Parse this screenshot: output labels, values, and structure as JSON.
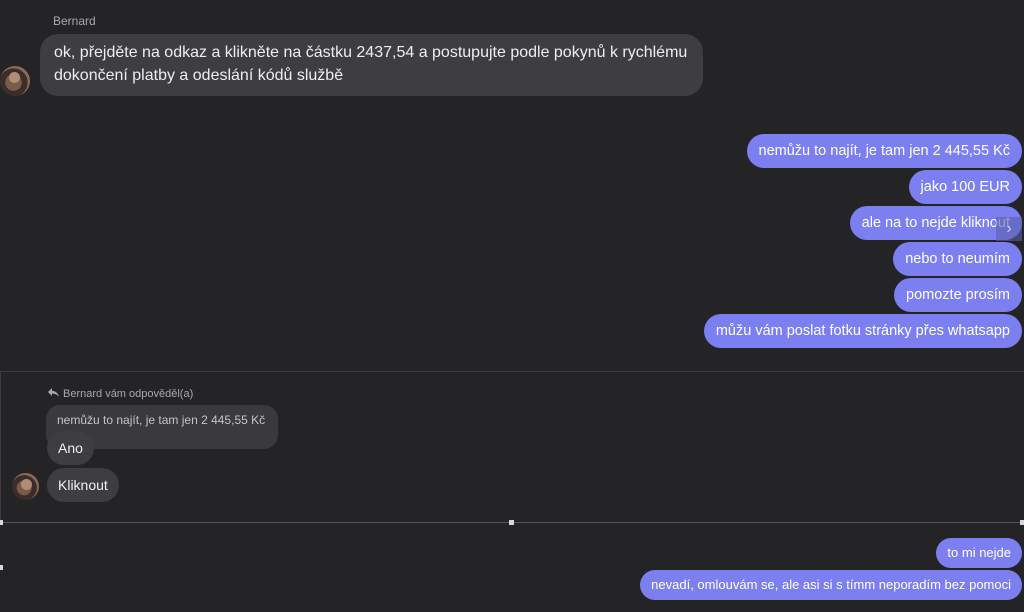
{
  "top_thread": {
    "sender": "Bernard",
    "incoming_message": "ok, přejděte na odkaz a klikněte na částku 2437,54 a postupujte podle pokynů k rychlému dokončení platby a odeslání kódů službě",
    "outgoing": [
      "nemůžu to najít, je tam jen 2 445,55 Kč",
      "jako 100 EUR",
      "ale na to nejde kliknout",
      "nebo to neumím",
      "pomozte prosím",
      "můžu vám poslat fotku stránky přes whatsapp"
    ],
    "nav_arrow": "›"
  },
  "reply_thread": {
    "reply_label": "Bernard vám odpověděl(a)",
    "reply_icon": "reply-arrow-icon",
    "quoted_message": "nemůžu to najít, je tam jen 2 445,55 Kč",
    "replies": [
      "Ano",
      "Kliknout"
    ]
  },
  "bottom_thread": {
    "outgoing": [
      "to mi nejde",
      "nevadí, omlouvám se, ale asi si s tímm neporadím bez pomoci"
    ]
  },
  "colors": {
    "background": "#242426",
    "incoming_bubble": "#3e3e42",
    "outgoing_bubble": "#7b7ff0"
  }
}
